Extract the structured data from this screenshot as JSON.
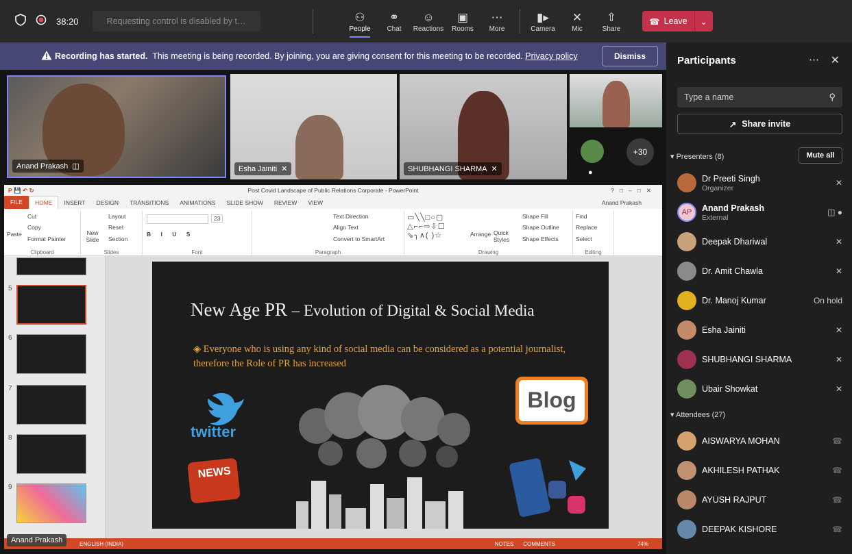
{
  "topbar": {
    "timer": "38:20",
    "requesting": "Requesting control is disabled by t…",
    "buttons": [
      {
        "label": "People",
        "icon": "people-icon"
      },
      {
        "label": "Chat",
        "icon": "chat-icon"
      },
      {
        "label": "Reactions",
        "icon": "reactions-icon"
      },
      {
        "label": "Rooms",
        "icon": "rooms-icon"
      },
      {
        "label": "More",
        "icon": "more-icon"
      }
    ],
    "media": [
      {
        "label": "Camera"
      },
      {
        "label": "Mic"
      },
      {
        "label": "Share"
      }
    ],
    "leave": "Leave"
  },
  "banner": {
    "bold": "Recording has started.",
    "text": "This meeting is being recorded. By joining, you are giving consent for this meeting to be recorded.",
    "link": "Privacy policy",
    "dismiss": "Dismiss"
  },
  "tiles": {
    "t1": "Anand Prakash",
    "t2": "Esha Jainiti",
    "t3": "SHUBHANGI SHARMA",
    "more": "+30",
    "bottom": "Anand Prakash"
  },
  "ppt": {
    "title": "Post Covid Landscape of Public Relations Corporate - PowerPoint",
    "user": "Anand Prakash",
    "tabs": [
      "FILE",
      "HOME",
      "INSERT",
      "DESIGN",
      "TRANSITIONS",
      "ANIMATIONS",
      "SLIDE SHOW",
      "REVIEW",
      "VIEW"
    ],
    "groups": [
      "Clipboard",
      "Slides",
      "Font",
      "Paragraph",
      "Drawing",
      "Editing"
    ],
    "clip": {
      "cut": "Cut",
      "copy": "Copy",
      "paste": "Paste",
      "painter": "Format Painter"
    },
    "slides": {
      "layout": "Layout",
      "reset": "Reset",
      "new": "New Slide",
      "section": "Section"
    },
    "font_size": "23",
    "para": {
      "dir": "Text Direction",
      "align": "Align Text",
      "smart": "Convert to SmartArt"
    },
    "draw": {
      "arrange": "Arrange",
      "quick": "Quick Styles",
      "fill": "Shape Fill",
      "outline": "Shape Outline",
      "effects": "Shape Effects"
    },
    "edit": {
      "find": "Find",
      "replace": "Replace",
      "select": "Select"
    },
    "thumbs": [
      "5",
      "6",
      "7",
      "8",
      "9"
    ],
    "slide": {
      "title": "New Age PR",
      "title_sub": "– Evolution of Digital & Social Media",
      "bullet": "Everyone who is using any kind of social media can be considered as a potential journalist, therefore the Role of PR has increased",
      "twitter": "twitter",
      "blog": "Blog",
      "news": "NEWS"
    },
    "status": {
      "lang": "ENGLISH (INDIA)",
      "notes": "NOTES",
      "comments": "COMMENTS",
      "zoom": "74%"
    }
  },
  "panel": {
    "title": "Participants",
    "search_placeholder": "Type a name",
    "share": "Share invite",
    "presenters_label": "Presenters (8)",
    "mute_all": "Mute all",
    "attendees_label": "Attendees (27)",
    "presenters": [
      {
        "name": "Dr Preeti  Singh",
        "role": "Organizer",
        "status": "muted",
        "color": "#b86a3c"
      },
      {
        "name": "Anand Prakash",
        "role": "External",
        "status": "active",
        "initials": "AP",
        "color": "#f1c6cf"
      },
      {
        "name": "Deepak Dhariwal",
        "status": "muted",
        "color": "#c7a27a"
      },
      {
        "name": "Dr. Amit Chawla",
        "status": "muted",
        "color": "#8a8a8a"
      },
      {
        "name": "Dr. Manoj Kumar",
        "status": "On hold",
        "color": "#e0b020"
      },
      {
        "name": "Esha Jainiti",
        "status": "muted",
        "color": "#c58a6a"
      },
      {
        "name": "SHUBHANGI SHARMA",
        "status": "muted",
        "color": "#a03050"
      },
      {
        "name": "Ubair Showkat",
        "status": "muted",
        "color": "#6f8f5f"
      }
    ],
    "attendees": [
      {
        "name": "AISWARYA MOHAN",
        "color": "#d4a070"
      },
      {
        "name": "AKHILESH PATHAK",
        "color": "#c09070"
      },
      {
        "name": "AYUSH RAJPUT",
        "color": "#b88868"
      },
      {
        "name": "DEEPAK KISHORE",
        "color": "#6688aa"
      }
    ]
  }
}
